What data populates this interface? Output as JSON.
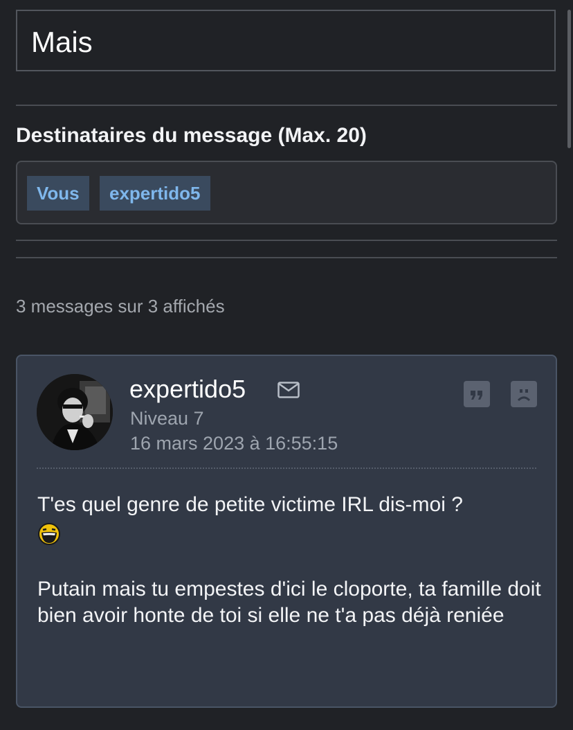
{
  "subject": "Mais",
  "recipients": {
    "title": "Destinataires du message (Max. 20)",
    "tags": [
      "Vous",
      "expertido5"
    ]
  },
  "messages_count": "3 messages sur 3 affichés",
  "message": {
    "author": "expertido5",
    "level": "Niveau 7",
    "date": "16 mars 2023 à 16:55:15",
    "line1": "T'es quel genre de petite victime IRL dis-moi ?",
    "emoji": "laughing-smiley-icon",
    "line2": "Putain mais tu empestes d'ici le cloporte, ta famille doit bien avoir honte de toi si elle ne t'a pas déjà reniée"
  },
  "colors": {
    "background": "#202226",
    "card": "#323946",
    "tag_bg": "#3a4a5e",
    "tag_text": "#7fb7ec"
  }
}
